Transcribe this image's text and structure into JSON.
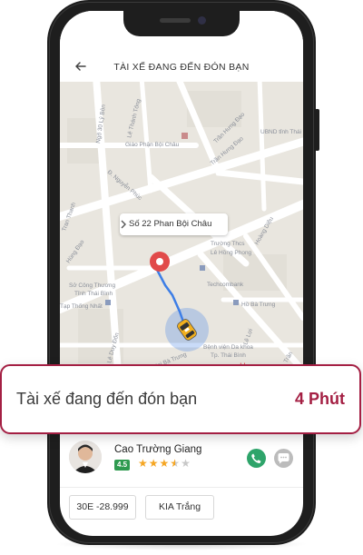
{
  "header": {
    "title": "TÀI XẾ ĐANG ĐẾN ĐÓN BẠN"
  },
  "map": {
    "address": "Số 22 Phan Bội Châu",
    "labels": {
      "ngo_30_ly_bon": "Ngõ 30 Lý Bôn",
      "le_thanh_tong": "Lê Thánh Tông",
      "giao_phan_boi_chau": "Giáo Phận Bội Châu",
      "tran_hung_dao_1": "Trần Hưng Đạo",
      "ubnd": "UBND tỉnh Thái",
      "nguyen_phuc": "Đ. Nguyễn Phúc",
      "tran_hung_dao_2": "Trần Hưng Đạo",
      "tran_thanh": "Tran Thanh",
      "hung_dao": "Hùng Đạo",
      "truong_thcs": "Trường Thcs",
      "le_hong_phong": "Lê Hồng Phong",
      "hoang_dieu": "Hoàng Diệu",
      "so_cong_thuong": "Sở Công Thương",
      "tinh_thai_binh": "Tỉnh Thái Bình",
      "techcombank": "Techcombank",
      "ho_ba_trung": "Hồ Bà Trưng",
      "tap_thong_nhat": "Tạp Thống Nhất",
      "le_duy_don": "Lê Duy Đốn",
      "hai_ba_trung": "Hai Bà Trưng",
      "benh_vien": "Bệnh viện Da khoa",
      "tp_thai_binh": "Tp. Thái Bình",
      "le_loi": "Lê Lợi",
      "tran_2": "Trần"
    }
  },
  "eta": {
    "text": "Tài xế đang đến đón bạn",
    "time": "4 Phút"
  },
  "driver": {
    "name": "Cao Trường Giang",
    "rating": "4.5",
    "stars_filled": 3.5,
    "stars_total": 5
  },
  "vehicle": {
    "plate": "30E -28.999",
    "model": "KIA Trắng"
  },
  "colors": {
    "accent": "#a41f43",
    "route": "#3d7ee6",
    "rating_badge": "#2e9a4f",
    "call": "#2ea46a"
  },
  "icons": {
    "back": "arrow-left-icon",
    "pickup": "map-pin-icon",
    "car": "taxi-car-icon",
    "call": "phone-icon",
    "chat": "chat-bubble-icon"
  }
}
